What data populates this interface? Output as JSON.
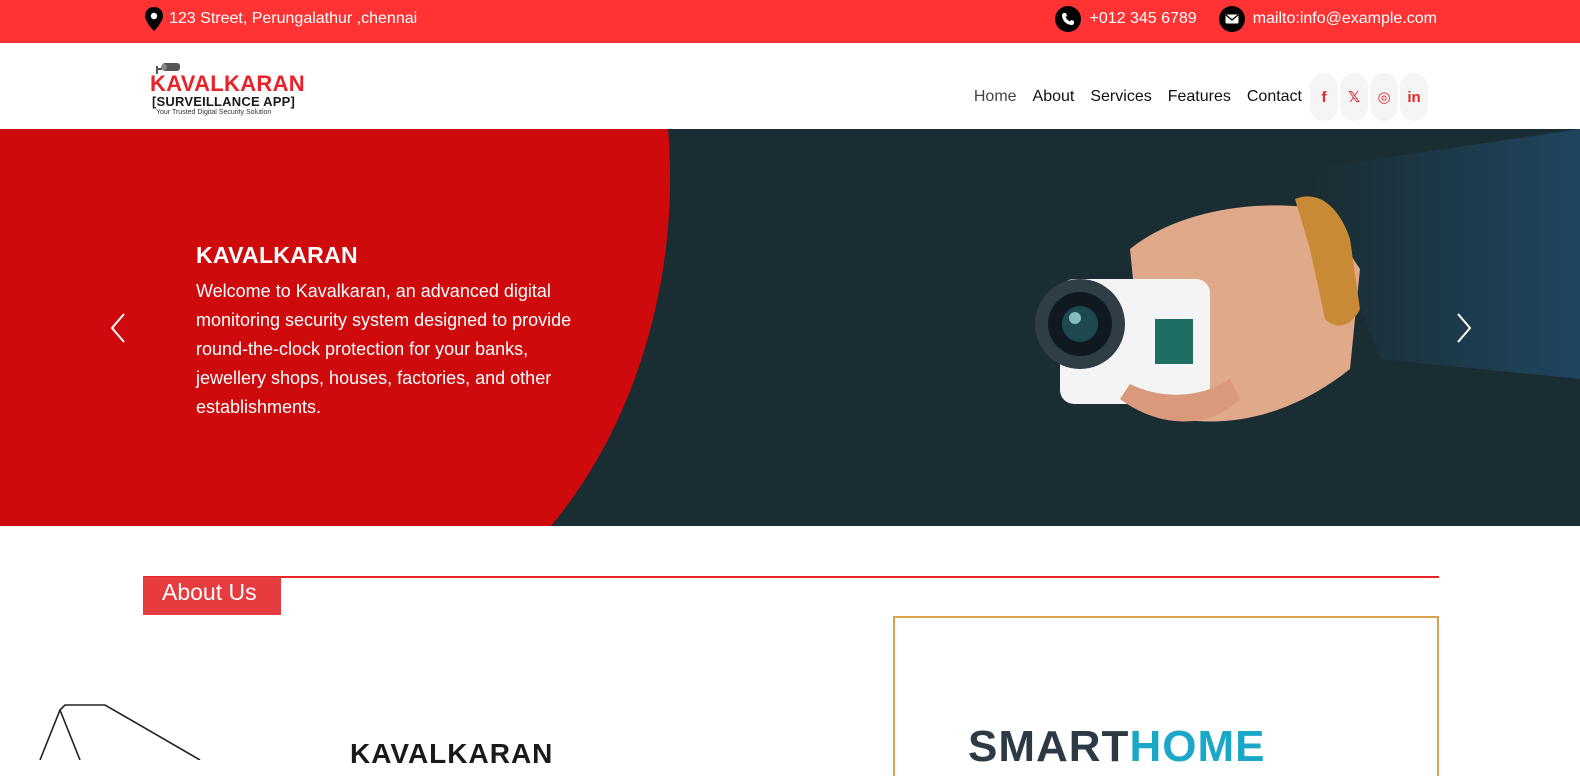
{
  "topbar": {
    "address": "123 Street, Perungalathur ,chennai",
    "phone": "+012 345 6789",
    "email": "mailto:info@example.com",
    "bg_color": "#ff3333"
  },
  "logo": {
    "brand": "KAVALKARAN",
    "subtitle": "[SURVEILLANCE APP]",
    "tagline": "Your Trusted Digital Security Solution"
  },
  "nav": {
    "items": [
      "Home",
      "About",
      "Services",
      "Features",
      "Contact"
    ],
    "active": "Home",
    "social_icons": [
      "facebook-icon",
      "x-icon",
      "instagram-icon",
      "linkedin-icon"
    ],
    "social_glyphs": [
      "f",
      "𝕏",
      "◎",
      "in"
    ]
  },
  "hero": {
    "title": "KAVALKARAN",
    "description": "Welcome to Kavalkaran, an advanced digital monitoring security system designed to provide round-the-clock protection for your banks, jewellery shops, houses, factories, and other establishments.",
    "red_color": "#cf0a0d",
    "dark_color": "#1a2d32"
  },
  "about": {
    "heading": "About Us",
    "title": "KAVALKARAN",
    "image_text_part1": "SMART",
    "image_text_part2": "HOME"
  }
}
